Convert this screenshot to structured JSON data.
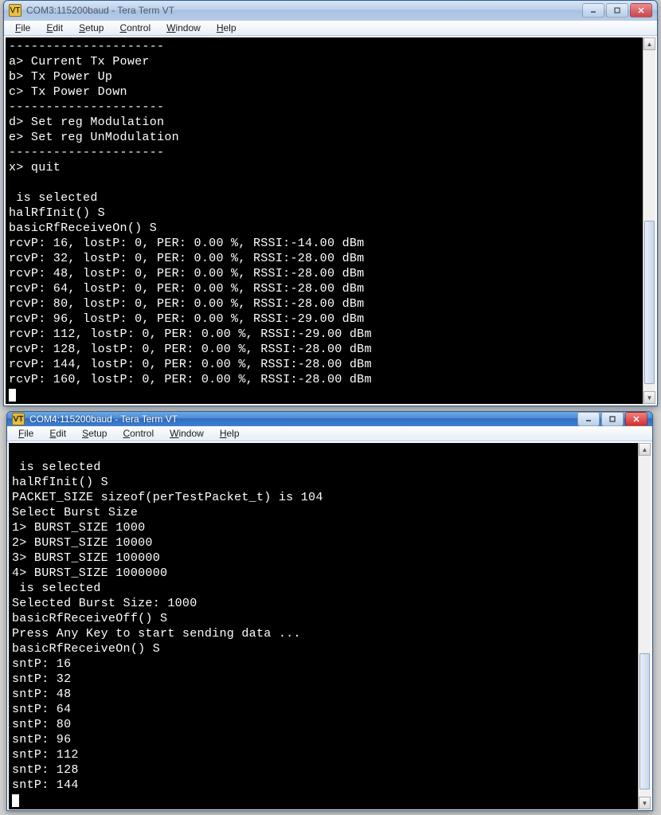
{
  "win1": {
    "title": "COM3:115200baud - Tera Term VT",
    "menu": [
      "File",
      "Edit",
      "Setup",
      "Control",
      "Window",
      "Help"
    ],
    "lines": [
      "---------------------",
      "a> Current Tx Power",
      "b> Tx Power Up",
      "c> Tx Power Down",
      "---------------------",
      "d> Set reg Modulation",
      "e> Set reg UnModulation",
      "---------------------",
      "x> quit",
      "",
      " is selected",
      "halRfInit() S",
      "basicRfReceiveOn() S",
      "rcvP: 16, lostP: 0, PER: 0.00 %, RSSI:-14.00 dBm",
      "rcvP: 32, lostP: 0, PER: 0.00 %, RSSI:-28.00 dBm",
      "rcvP: 48, lostP: 0, PER: 0.00 %, RSSI:-28.00 dBm",
      "rcvP: 64, lostP: 0, PER: 0.00 %, RSSI:-28.00 dBm",
      "rcvP: 80, lostP: 0, PER: 0.00 %, RSSI:-28.00 dBm",
      "rcvP: 96, lostP: 0, PER: 0.00 %, RSSI:-29.00 dBm",
      "rcvP: 112, lostP: 0, PER: 0.00 %, RSSI:-29.00 dBm",
      "rcvP: 128, lostP: 0, PER: 0.00 %, RSSI:-28.00 dBm",
      "rcvP: 144, lostP: 0, PER: 0.00 %, RSSI:-28.00 dBm",
      "rcvP: 160, lostP: 0, PER: 0.00 %, RSSI:-28.00 dBm"
    ]
  },
  "win2": {
    "title": "COM4:115200baud - Tera Term VT",
    "menu": [
      "File",
      "Edit",
      "Setup",
      "Control",
      "Window",
      "Help"
    ],
    "lines": [
      "",
      " is selected",
      "halRfInit() S",
      "PACKET_SIZE sizeof(perTestPacket_t) is 104",
      "Select Burst Size",
      "1> BURST_SIZE 1000",
      "2> BURST_SIZE 10000",
      "3> BURST_SIZE 100000",
      "4> BURST_SIZE 1000000",
      " is selected",
      "Selected Burst Size: 1000",
      "basicRfReceiveOff() S",
      "Press Any Key to start sending data ...",
      "basicRfReceiveOn() S",
      "sntP: 16",
      "sntP: 32",
      "sntP: 48",
      "sntP: 64",
      "sntP: 80",
      "sntP: 96",
      "sntP: 112",
      "sntP: 128",
      "sntP: 144"
    ]
  }
}
